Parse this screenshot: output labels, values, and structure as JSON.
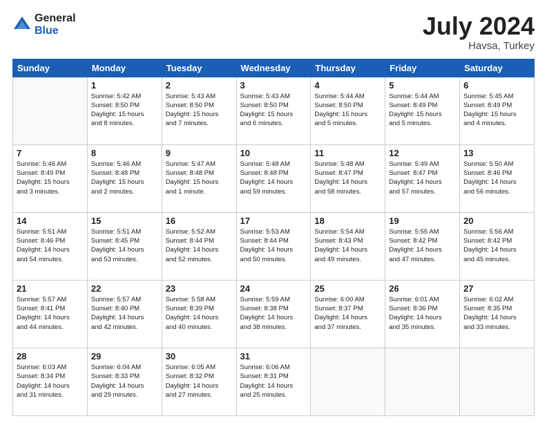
{
  "logo": {
    "general": "General",
    "blue": "Blue"
  },
  "header": {
    "month_year": "July 2024",
    "location": "Havsa, Turkey"
  },
  "days_of_week": [
    "Sunday",
    "Monday",
    "Tuesday",
    "Wednesday",
    "Thursday",
    "Friday",
    "Saturday"
  ],
  "weeks": [
    [
      {
        "day": "",
        "info": ""
      },
      {
        "day": "1",
        "info": "Sunrise: 5:42 AM\nSunset: 8:50 PM\nDaylight: 15 hours\nand 8 minutes."
      },
      {
        "day": "2",
        "info": "Sunrise: 5:43 AM\nSunset: 8:50 PM\nDaylight: 15 hours\nand 7 minutes."
      },
      {
        "day": "3",
        "info": "Sunrise: 5:43 AM\nSunset: 8:50 PM\nDaylight: 15 hours\nand 6 minutes."
      },
      {
        "day": "4",
        "info": "Sunrise: 5:44 AM\nSunset: 8:50 PM\nDaylight: 15 hours\nand 5 minutes."
      },
      {
        "day": "5",
        "info": "Sunrise: 5:44 AM\nSunset: 8:49 PM\nDaylight: 15 hours\nand 5 minutes."
      },
      {
        "day": "6",
        "info": "Sunrise: 5:45 AM\nSunset: 8:49 PM\nDaylight: 15 hours\nand 4 minutes."
      }
    ],
    [
      {
        "day": "7",
        "info": "Sunrise: 5:46 AM\nSunset: 8:49 PM\nDaylight: 15 hours\nand 3 minutes."
      },
      {
        "day": "8",
        "info": "Sunrise: 5:46 AM\nSunset: 8:48 PM\nDaylight: 15 hours\nand 2 minutes."
      },
      {
        "day": "9",
        "info": "Sunrise: 5:47 AM\nSunset: 8:48 PM\nDaylight: 15 hours\nand 1 minute."
      },
      {
        "day": "10",
        "info": "Sunrise: 5:48 AM\nSunset: 8:48 PM\nDaylight: 14 hours\nand 59 minutes."
      },
      {
        "day": "11",
        "info": "Sunrise: 5:48 AM\nSunset: 8:47 PM\nDaylight: 14 hours\nand 58 minutes."
      },
      {
        "day": "12",
        "info": "Sunrise: 5:49 AM\nSunset: 8:47 PM\nDaylight: 14 hours\nand 57 minutes."
      },
      {
        "day": "13",
        "info": "Sunrise: 5:50 AM\nSunset: 8:46 PM\nDaylight: 14 hours\nand 56 minutes."
      }
    ],
    [
      {
        "day": "14",
        "info": "Sunrise: 5:51 AM\nSunset: 8:46 PM\nDaylight: 14 hours\nand 54 minutes."
      },
      {
        "day": "15",
        "info": "Sunrise: 5:51 AM\nSunset: 8:45 PM\nDaylight: 14 hours\nand 53 minutes."
      },
      {
        "day": "16",
        "info": "Sunrise: 5:52 AM\nSunset: 8:44 PM\nDaylight: 14 hours\nand 52 minutes."
      },
      {
        "day": "17",
        "info": "Sunrise: 5:53 AM\nSunset: 8:44 PM\nDaylight: 14 hours\nand 50 minutes."
      },
      {
        "day": "18",
        "info": "Sunrise: 5:54 AM\nSunset: 8:43 PM\nDaylight: 14 hours\nand 49 minutes."
      },
      {
        "day": "19",
        "info": "Sunrise: 5:55 AM\nSunset: 8:42 PM\nDaylight: 14 hours\nand 47 minutes."
      },
      {
        "day": "20",
        "info": "Sunrise: 5:56 AM\nSunset: 8:42 PM\nDaylight: 14 hours\nand 45 minutes."
      }
    ],
    [
      {
        "day": "21",
        "info": "Sunrise: 5:57 AM\nSunset: 8:41 PM\nDaylight: 14 hours\nand 44 minutes."
      },
      {
        "day": "22",
        "info": "Sunrise: 5:57 AM\nSunset: 8:40 PM\nDaylight: 14 hours\nand 42 minutes."
      },
      {
        "day": "23",
        "info": "Sunrise: 5:58 AM\nSunset: 8:39 PM\nDaylight: 14 hours\nand 40 minutes."
      },
      {
        "day": "24",
        "info": "Sunrise: 5:59 AM\nSunset: 8:38 PM\nDaylight: 14 hours\nand 38 minutes."
      },
      {
        "day": "25",
        "info": "Sunrise: 6:00 AM\nSunset: 8:37 PM\nDaylight: 14 hours\nand 37 minutes."
      },
      {
        "day": "26",
        "info": "Sunrise: 6:01 AM\nSunset: 8:36 PM\nDaylight: 14 hours\nand 35 minutes."
      },
      {
        "day": "27",
        "info": "Sunrise: 6:02 AM\nSunset: 8:35 PM\nDaylight: 14 hours\nand 33 minutes."
      }
    ],
    [
      {
        "day": "28",
        "info": "Sunrise: 6:03 AM\nSunset: 8:34 PM\nDaylight: 14 hours\nand 31 minutes."
      },
      {
        "day": "29",
        "info": "Sunrise: 6:04 AM\nSunset: 8:33 PM\nDaylight: 14 hours\nand 29 minutes."
      },
      {
        "day": "30",
        "info": "Sunrise: 6:05 AM\nSunset: 8:32 PM\nDaylight: 14 hours\nand 27 minutes."
      },
      {
        "day": "31",
        "info": "Sunrise: 6:06 AM\nSunset: 8:31 PM\nDaylight: 14 hours\nand 25 minutes."
      },
      {
        "day": "",
        "info": ""
      },
      {
        "day": "",
        "info": ""
      },
      {
        "day": "",
        "info": ""
      }
    ]
  ]
}
